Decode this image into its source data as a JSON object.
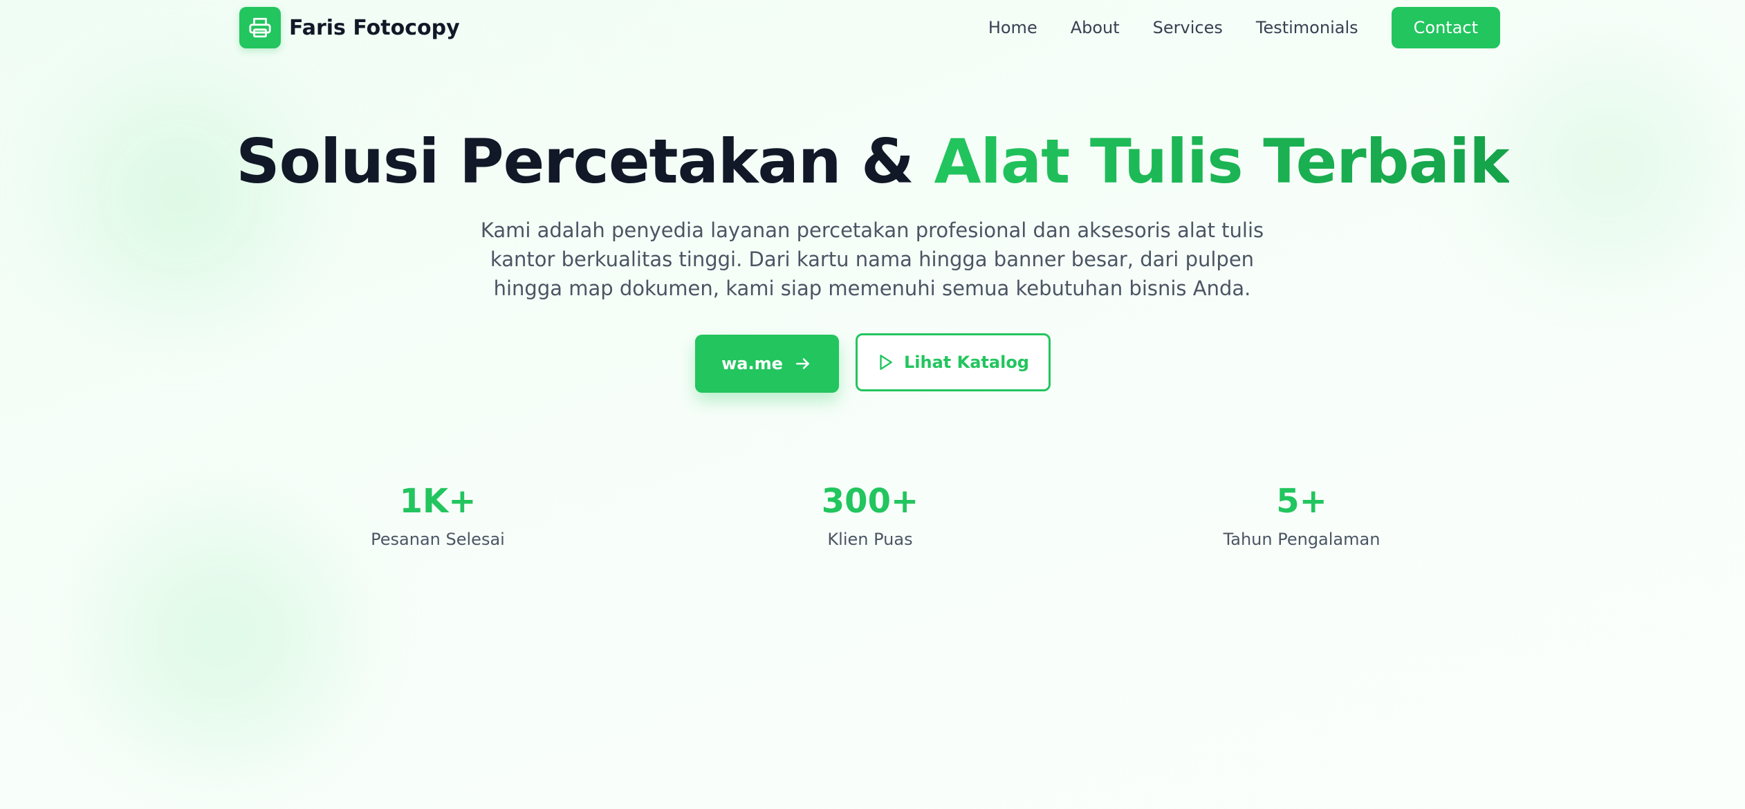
{
  "brand": {
    "name": "Faris Fotocopy",
    "logo_icon": "printer-icon",
    "accent_color": "#22c55e"
  },
  "nav": {
    "links": [
      "Home",
      "About",
      "Services",
      "Testimonials"
    ],
    "contact_label": "Contact"
  },
  "hero": {
    "title_main": "Solusi Percetakan & ",
    "title_accent": "Alat Tulis Terbaik",
    "description": "Kami adalah penyedia layanan percetakan profesional dan aksesoris alat tulis kantor berkualitas tinggi. Dari kartu nama hingga banner besar, dari pulpen hingga map dokumen, kami siap memenuhi semua kebutuhan bisnis Anda.",
    "primary_button": {
      "label": "wa.me",
      "icon": "arrow-right-icon"
    },
    "secondary_button": {
      "label": "Lihat Katalog",
      "icon": "play-icon"
    }
  },
  "stats": [
    {
      "value": "1K+",
      "label": "Pesanan Selesai"
    },
    {
      "value": "300+",
      "label": "Klien Puas"
    },
    {
      "value": "5+",
      "label": "Tahun Pengalaman"
    }
  ]
}
